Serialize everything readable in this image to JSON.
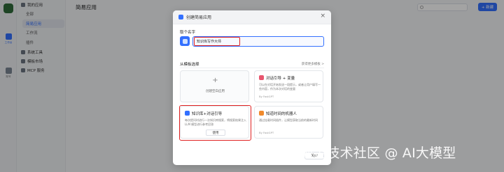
{
  "rail": {
    "items": [
      {
        "label": "工作台",
        "icon": "apps-icon"
      },
      {
        "label": "账号",
        "icon": "account-icon"
      }
    ]
  },
  "sidebar": {
    "groups": [
      {
        "label": "我的应用",
        "icon": "app-group-icon",
        "items": [
          "全部",
          "简易应用",
          "工作流",
          "插件"
        ]
      },
      {
        "label": "系统工具",
        "icon": "tools-icon",
        "items": []
      },
      {
        "label": "模板市场",
        "icon": "market-icon",
        "items": []
      },
      {
        "label": "MCP 服务",
        "icon": "mcp-icon",
        "items": []
      }
    ],
    "active_item": "简易应用"
  },
  "header": {
    "title": "简易应用",
    "create_label": "+ 新建"
  },
  "modal": {
    "title": "创建简易应用",
    "name_label": "取个名字",
    "name_value": "知识库写作大师",
    "templates_label": "从模板选择",
    "templates_more": "获得更多模板 >",
    "blank_card_label": "创建空白应用",
    "cards": [
      {
        "title": "对话引导 + 变量",
        "desc": "可以在对话开始发送一段提示，或者让用户填写一些内容，作为本次对话的变量",
        "author": "By FastGPT",
        "icon_color": "#e8566f"
      },
      {
        "title": "知识库+对话引导",
        "desc": "每次提问时进行一次知识库搜索，将搜索结果注入 LLM 模型进行参考回答",
        "button": "使用",
        "icon_color": "#3370ff"
      },
      {
        "title": "知道时间的机器人",
        "desc": "通过挂载时间插件，让模型获取当前的最新时间",
        "author": "By FastGPT",
        "icon_color": "#f08a2c"
      }
    ],
    "close_label": "关闭"
  },
  "watermark": "掘金技术社区 @ AI大模型"
}
